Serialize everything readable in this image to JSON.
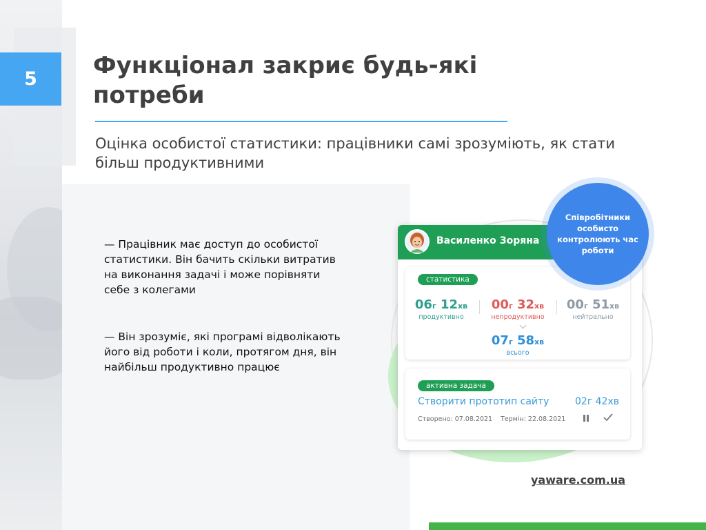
{
  "slide": {
    "number": "5",
    "title": "Функціонал закриє будь-які потреби",
    "subtitle": "Оцінка особистої статистики: працівники самі зрозуміють, як стати більш продуктивними"
  },
  "bullets": [
    "— Працівник має доступ до особистої статистики. Він бачить скільки витратив на виконання задачі і може порівняти себе з колегами",
    "— Він зрозуміє, які програмі відволікають його від роботи і коли, протягом дня, він найбільш продуктивно працює"
  ],
  "card": {
    "user_name": "Василенко Зоряна",
    "stats_label": "статистика",
    "stats": {
      "productive": {
        "hours": "06",
        "h_unit": "г",
        "minutes": "12",
        "m_unit": "хв",
        "label": "продуктивно"
      },
      "unproductive": {
        "hours": "00",
        "h_unit": "г",
        "minutes": "32",
        "m_unit": "хв",
        "label": "непродуктивно"
      },
      "neutral": {
        "hours": "00",
        "h_unit": "г",
        "minutes": "51",
        "m_unit": "хв",
        "label": "нейтрально"
      },
      "total": {
        "hours": "07",
        "h_unit": "г",
        "minutes": "58",
        "m_unit": "хв",
        "label": "всього"
      }
    },
    "task": {
      "label": "активна задача",
      "name": "Створити прототип сайту",
      "time": "02г 42хв",
      "created": "Створено: 07.08.2021",
      "due": "Термін: 22.08.2021"
    }
  },
  "badge_text": "Співробітники особисто контролюють час роботи",
  "site_link": "yaware.com.ua",
  "colors": {
    "accent_blue": "#46a6f2",
    "brand_green": "#1e9f55",
    "badge_blue": "#3f86ea",
    "bottom_bar_green": "#42b44a"
  },
  "icons": [
    "avatar-icon",
    "chevron-down-icon",
    "pause-icon",
    "check-icon"
  ]
}
